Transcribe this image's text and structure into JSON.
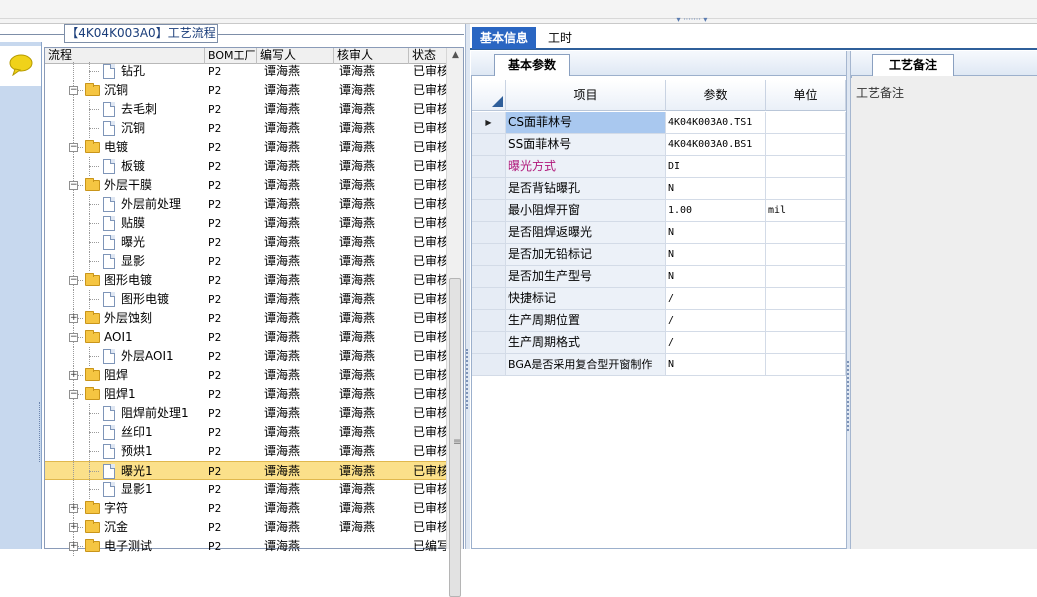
{
  "tree": {
    "title": "【4K04K003A0】工艺流程",
    "columns": [
      "流程",
      "BOM工厂",
      "编写人",
      "核审人",
      "状态"
    ],
    "rows": [
      {
        "name": "钻孔",
        "level": 2,
        "type": "doc",
        "bom": "P2",
        "writer": "谭海燕",
        "reviewer": "谭海燕",
        "status": "已审核"
      },
      {
        "name": "沉铜",
        "level": 1,
        "type": "folder",
        "bom": "P2",
        "writer": "谭海燕",
        "reviewer": "谭海燕",
        "status": "已审核"
      },
      {
        "name": "去毛刺",
        "level": 2,
        "type": "doc",
        "bom": "P2",
        "writer": "谭海燕",
        "reviewer": "谭海燕",
        "status": "已审核"
      },
      {
        "name": "沉铜",
        "level": 2,
        "type": "doc",
        "bom": "P2",
        "writer": "谭海燕",
        "reviewer": "谭海燕",
        "status": "已审核"
      },
      {
        "name": "电镀",
        "level": 1,
        "type": "folder",
        "bom": "P2",
        "writer": "谭海燕",
        "reviewer": "谭海燕",
        "status": "已审核"
      },
      {
        "name": "板镀",
        "level": 2,
        "type": "doc",
        "bom": "P2",
        "writer": "谭海燕",
        "reviewer": "谭海燕",
        "status": "已审核"
      },
      {
        "name": "外层干膜",
        "level": 1,
        "type": "folder",
        "bom": "P2",
        "writer": "谭海燕",
        "reviewer": "谭海燕",
        "status": "已审核"
      },
      {
        "name": "外层前处理",
        "level": 2,
        "type": "doc",
        "bom": "P2",
        "writer": "谭海燕",
        "reviewer": "谭海燕",
        "status": "已审核"
      },
      {
        "name": "贴膜",
        "level": 2,
        "type": "doc",
        "bom": "P2",
        "writer": "谭海燕",
        "reviewer": "谭海燕",
        "status": "已审核"
      },
      {
        "name": "曝光",
        "level": 2,
        "type": "doc",
        "bom": "P2",
        "writer": "谭海燕",
        "reviewer": "谭海燕",
        "status": "已审核"
      },
      {
        "name": "显影",
        "level": 2,
        "type": "doc",
        "bom": "P2",
        "writer": "谭海燕",
        "reviewer": "谭海燕",
        "status": "已审核"
      },
      {
        "name": "图形电镀",
        "level": 1,
        "type": "folder",
        "bom": "P2",
        "writer": "谭海燕",
        "reviewer": "谭海燕",
        "status": "已审核"
      },
      {
        "name": "图形电镀",
        "level": 2,
        "type": "doc",
        "bom": "P2",
        "writer": "谭海燕",
        "reviewer": "谭海燕",
        "status": "已审核"
      },
      {
        "name": "外层蚀刻",
        "level": 1,
        "type": "folder-collapsed",
        "bom": "P2",
        "writer": "谭海燕",
        "reviewer": "谭海燕",
        "status": "已审核"
      },
      {
        "name": "AOI1",
        "level": 1,
        "type": "folder",
        "bom": "P2",
        "writer": "谭海燕",
        "reviewer": "谭海燕",
        "status": "已审核"
      },
      {
        "name": "外层AOI1",
        "level": 2,
        "type": "doc",
        "bom": "P2",
        "writer": "谭海燕",
        "reviewer": "谭海燕",
        "status": "已审核"
      },
      {
        "name": "阻焊",
        "level": 1,
        "type": "folder-collapsed",
        "bom": "P2",
        "writer": "谭海燕",
        "reviewer": "谭海燕",
        "status": "已审核"
      },
      {
        "name": "阻焊1",
        "level": 1,
        "type": "folder",
        "bom": "P2",
        "writer": "谭海燕",
        "reviewer": "谭海燕",
        "status": "已审核"
      },
      {
        "name": "阻焊前处理1",
        "level": 2,
        "type": "doc",
        "bom": "P2",
        "writer": "谭海燕",
        "reviewer": "谭海燕",
        "status": "已审核"
      },
      {
        "name": "丝印1",
        "level": 2,
        "type": "doc",
        "bom": "P2",
        "writer": "谭海燕",
        "reviewer": "谭海燕",
        "status": "已审核"
      },
      {
        "name": "预烘1",
        "level": 2,
        "type": "doc",
        "bom": "P2",
        "writer": "谭海燕",
        "reviewer": "谭海燕",
        "status": "已审核"
      },
      {
        "name": "曝光1",
        "level": 2,
        "type": "doc",
        "bom": "P2",
        "writer": "谭海燕",
        "reviewer": "谭海燕",
        "status": "已审核",
        "selected": true
      },
      {
        "name": "显影1",
        "level": 2,
        "type": "doc",
        "bom": "P2",
        "writer": "谭海燕",
        "reviewer": "谭海燕",
        "status": "已审核"
      },
      {
        "name": "字符",
        "level": 1,
        "type": "folder-collapsed",
        "bom": "P2",
        "writer": "谭海燕",
        "reviewer": "谭海燕",
        "status": "已审核"
      },
      {
        "name": "沉金",
        "level": 1,
        "type": "folder-collapsed",
        "bom": "P2",
        "writer": "谭海燕",
        "reviewer": "谭海燕",
        "status": "已审核"
      },
      {
        "name": "电子测试",
        "level": 1,
        "type": "folder-collapsed",
        "bom": "P2",
        "writer": "谭海燕",
        "reviewer": "",
        "status": "已编写"
      }
    ]
  },
  "tabs": [
    "基本信息",
    "工时"
  ],
  "params": {
    "subtab": "基本参数",
    "columns": [
      "项目",
      "参数",
      "单位"
    ],
    "rows": [
      {
        "item": "CS面菲林号",
        "value": "4K04K003A0.TS1",
        "unit": "",
        "selected": true
      },
      {
        "item": "SS面菲林号",
        "value": "4K04K003A0.BS1",
        "unit": ""
      },
      {
        "item": "曝光方式",
        "value": "DI",
        "unit": "",
        "highlight": true
      },
      {
        "item": "是否背钻曝孔",
        "value": "N",
        "unit": ""
      },
      {
        "item": "最小阻焊开窗",
        "value": "1.00",
        "unit": "mil"
      },
      {
        "item": "是否阻焊返曝光",
        "value": "N",
        "unit": ""
      },
      {
        "item": "是否加无铅标记",
        "value": "N",
        "unit": ""
      },
      {
        "item": "是否加生产型号",
        "value": "N",
        "unit": ""
      },
      {
        "item": "快捷标记",
        "value": "/",
        "unit": ""
      },
      {
        "item": "生产周期位置",
        "value": "/",
        "unit": ""
      },
      {
        "item": "生产周期格式",
        "value": "/",
        "unit": ""
      },
      {
        "item": "BGA是否采用复合型开窗制作",
        "value": "N",
        "unit": ""
      }
    ]
  },
  "remarks": {
    "tab": "工艺备注",
    "label": "工艺备注"
  },
  "colors": {
    "accent": "#2a66c2",
    "selected_row": "#fbe08a",
    "highlight_item": "#b0187a"
  }
}
